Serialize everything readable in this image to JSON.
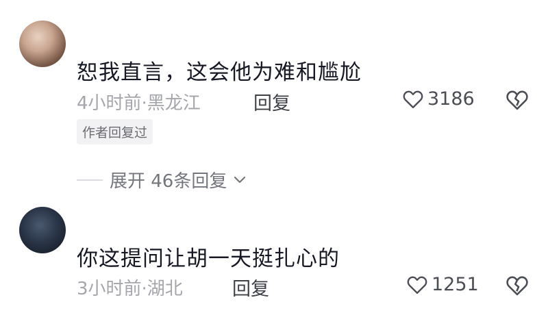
{
  "comments": [
    {
      "text": "恕我直言，这会他为难和尴尬",
      "time_location": "4小时前·黑龙江",
      "reply_label": "回复",
      "likes": "3186",
      "badge": "作者回复过",
      "expand_label": "展开 46条回复"
    },
    {
      "text": "你这提问让胡一天挺扎心的",
      "time_location": "3小时前·湖北",
      "reply_label": "回复",
      "likes": "1251"
    }
  ],
  "icons": {
    "like": "heart-outline-icon",
    "dislike": "broken-heart-icon",
    "expand": "chevron-down-icon"
  }
}
